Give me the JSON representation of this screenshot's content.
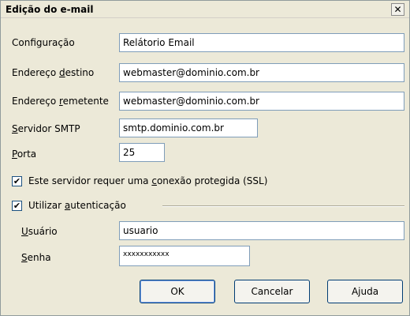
{
  "window": {
    "title": "Edição do e-mail",
    "close_glyph": "✕"
  },
  "fields": {
    "configuracao": {
      "label": "Configuração",
      "value": "Relátorio Email"
    },
    "destino": {
      "label_pre": "Endereço ",
      "label_ul": "d",
      "label_post": "estino",
      "value": "webmaster@dominio.com.br"
    },
    "remetente": {
      "label_pre": "Endereço ",
      "label_ul": "r",
      "label_post": "emetente",
      "value": "webmaster@dominio.com.br"
    },
    "servidor": {
      "label_pre": "",
      "label_ul": "S",
      "label_post": "ervidor SMTP",
      "value": "smtp.dominio.com.br"
    },
    "porta": {
      "label_pre": "",
      "label_ul": "P",
      "label_post": "orta",
      "value": "25"
    }
  },
  "ssl": {
    "checked_glyph": "✔",
    "label_pre": "Este servidor requer uma ",
    "label_ul": "c",
    "label_post": "onexão protegida (SSL)",
    "checked": true
  },
  "auth": {
    "checked_glyph": "✔",
    "checked": true,
    "label_pre": "Utilizar ",
    "label_ul": "a",
    "label_post": "utenticação",
    "usuario": {
      "label_pre": "",
      "label_ul": "U",
      "label_post": "suário",
      "value": "usuario"
    },
    "senha": {
      "label_pre": "",
      "label_ul": "S",
      "label_post": "enha",
      "value": "xxxxxxxxxxx"
    }
  },
  "buttons": {
    "ok": "OK",
    "cancelar": "Cancelar",
    "ajuda": "Ajuda"
  }
}
